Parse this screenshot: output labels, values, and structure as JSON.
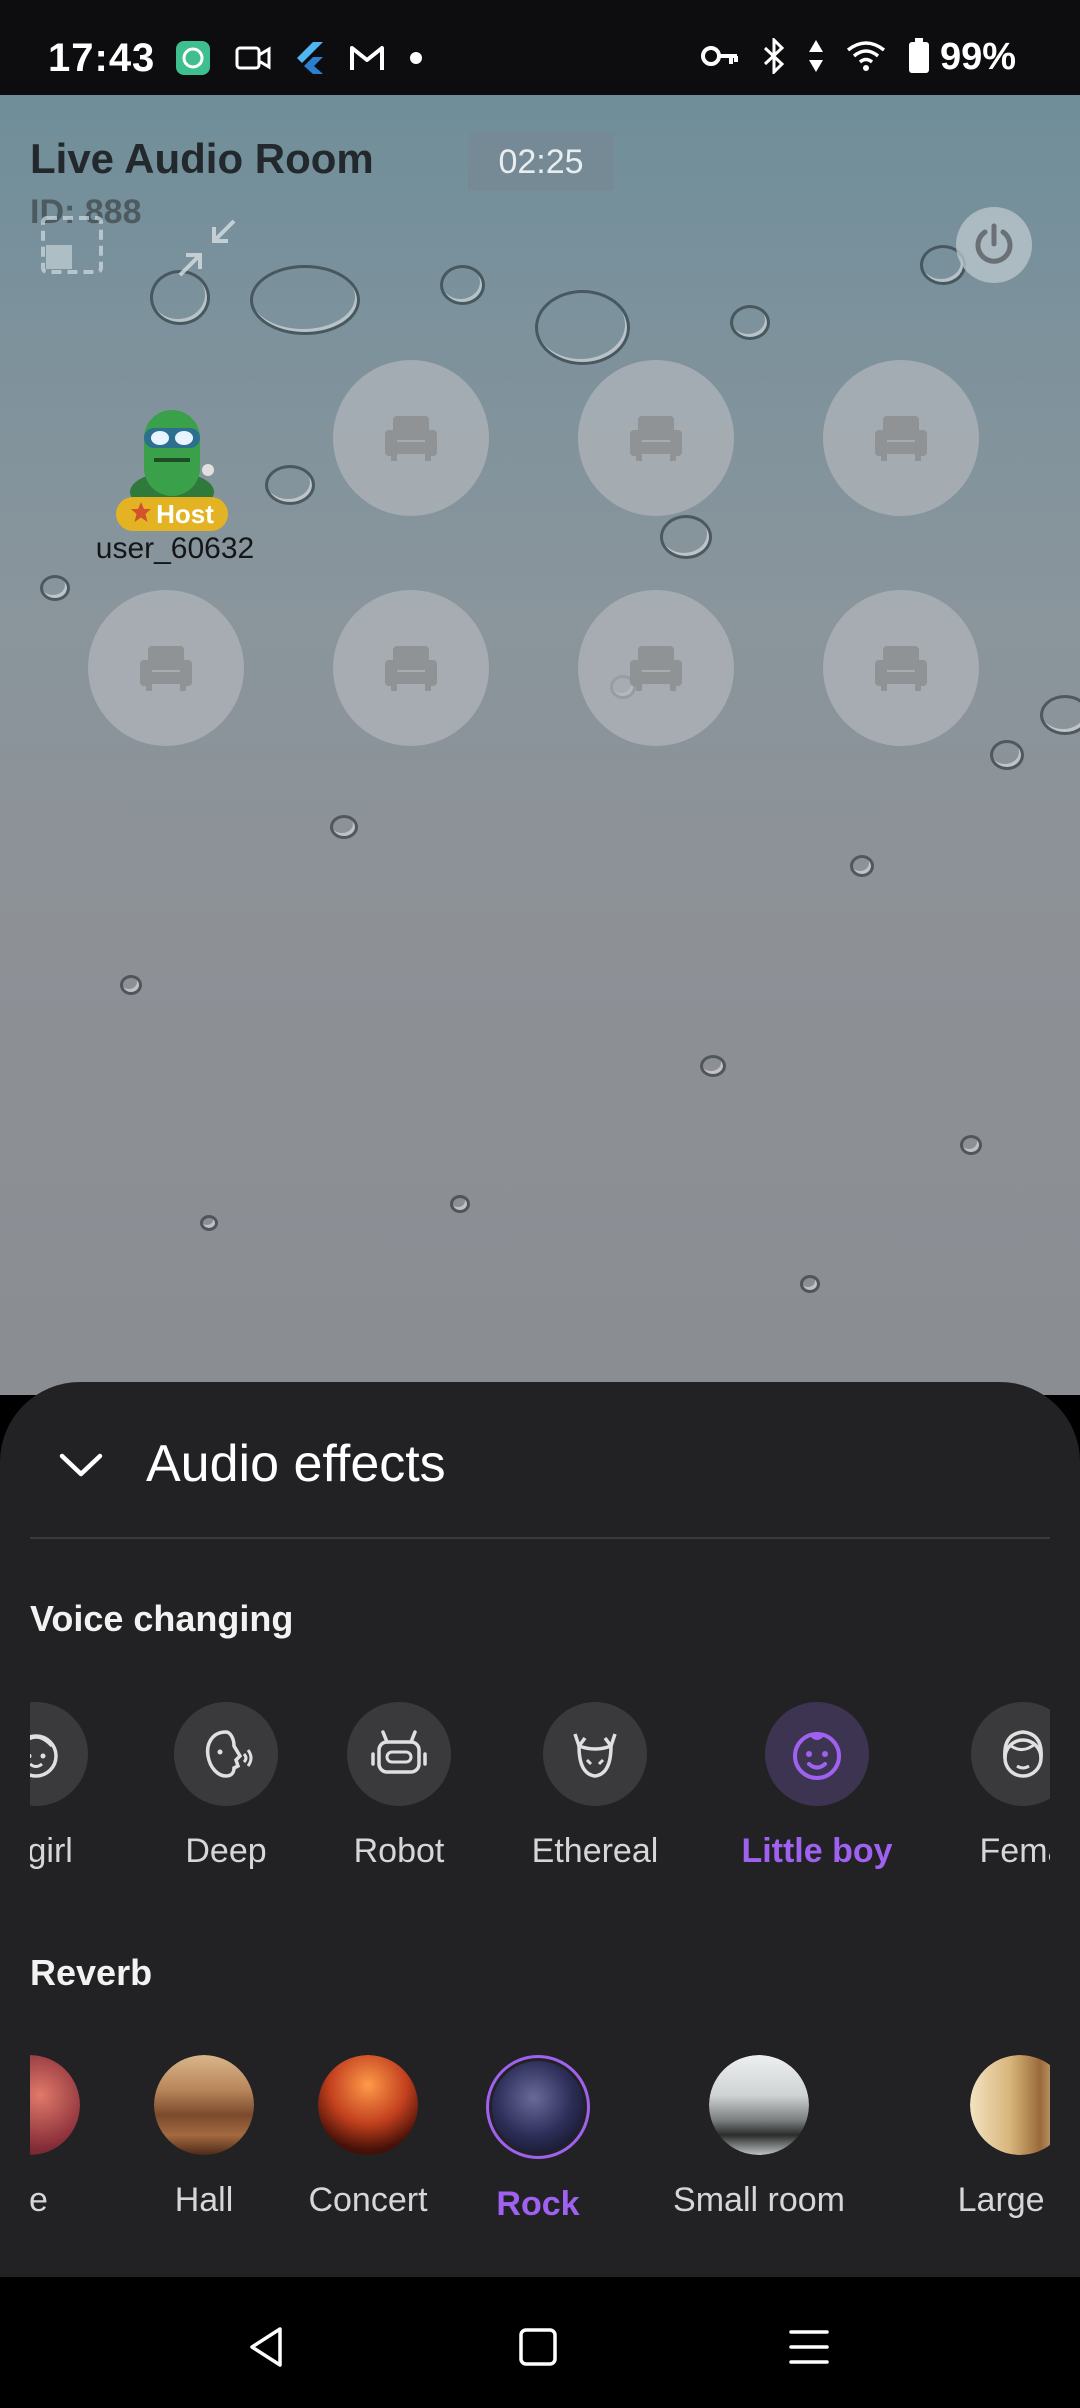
{
  "status_bar": {
    "time": "17:43",
    "battery": "99%",
    "left_icons": [
      "app-notification-icon",
      "video-icon",
      "flutter-icon",
      "gmail-icon",
      "dot-icon"
    ],
    "right_icons": [
      "vpn-key-icon",
      "bluetooth-icon",
      "data-arrows-icon",
      "wifi-icon",
      "battery-icon"
    ]
  },
  "room": {
    "title": "Live Audio Room",
    "id_text": "ID: 888",
    "timer": "02:25",
    "host": {
      "badge": "Host",
      "name": "user_60632"
    }
  },
  "sheet": {
    "title": "Audio effects",
    "voice_changing": {
      "title": "Voice changing",
      "items": [
        {
          "label": "e girl",
          "icon": "girl-face-icon",
          "selected": false
        },
        {
          "label": "Deep",
          "icon": "deep-voice-icon",
          "selected": false
        },
        {
          "label": "Robot",
          "icon": "robot-icon",
          "selected": false
        },
        {
          "label": "Ethereal",
          "icon": "ethereal-icon",
          "selected": false
        },
        {
          "label": "Little boy",
          "icon": "little-boy-icon",
          "selected": true
        },
        {
          "label": "Fema",
          "icon": "female-icon",
          "selected": false
        }
      ]
    },
    "reverb": {
      "title": "Reverb",
      "items": [
        {
          "label": "ke",
          "selected": false
        },
        {
          "label": "Hall",
          "selected": false
        },
        {
          "label": "Concert",
          "selected": false
        },
        {
          "label": "Rock",
          "selected": true
        },
        {
          "label": "Small room",
          "selected": false
        },
        {
          "label": "Large rc",
          "selected": false
        }
      ]
    }
  },
  "colors": {
    "accent": "#9f62f0",
    "sheet_bg": "#222224",
    "host_badge": "#e3b324"
  }
}
